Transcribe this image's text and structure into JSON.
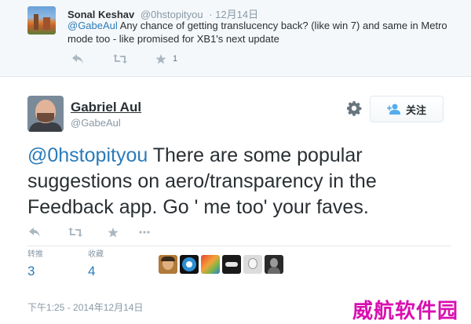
{
  "reply": {
    "name": "Sonal Keshav",
    "handle": "@0hstopityou",
    "time": "12月14日",
    "mention": "@GabeAul",
    "text": " Any chance of getting translucency back? (like win 7) and same in Metro mode too - like promised for XB1's next update",
    "actions": {
      "reply_icon": "reply-icon",
      "retweet_icon": "retweet-icon",
      "favorite_icon": "star-icon",
      "favorite_count": "1"
    }
  },
  "tweet": {
    "name": "Gabriel Aul",
    "handle": "@GabeAul",
    "follow_label": "关注",
    "mention": "@0hstopityou",
    "text": " There are some popular suggestions on aero/transparency in the Feedback app. Go ' me too' your faves.",
    "retweets_label": "转推",
    "retweets_count": "3",
    "favorites_label": "收藏",
    "favorites_count": "4",
    "timestamp": "下午1:25 - 2014年12月14日"
  },
  "colors": {
    "link": "#2b7bb9",
    "muted": "#8899a6",
    "icon": "#aab8c2",
    "watermark": "#d90fb0"
  },
  "watermark": "威航软件园"
}
